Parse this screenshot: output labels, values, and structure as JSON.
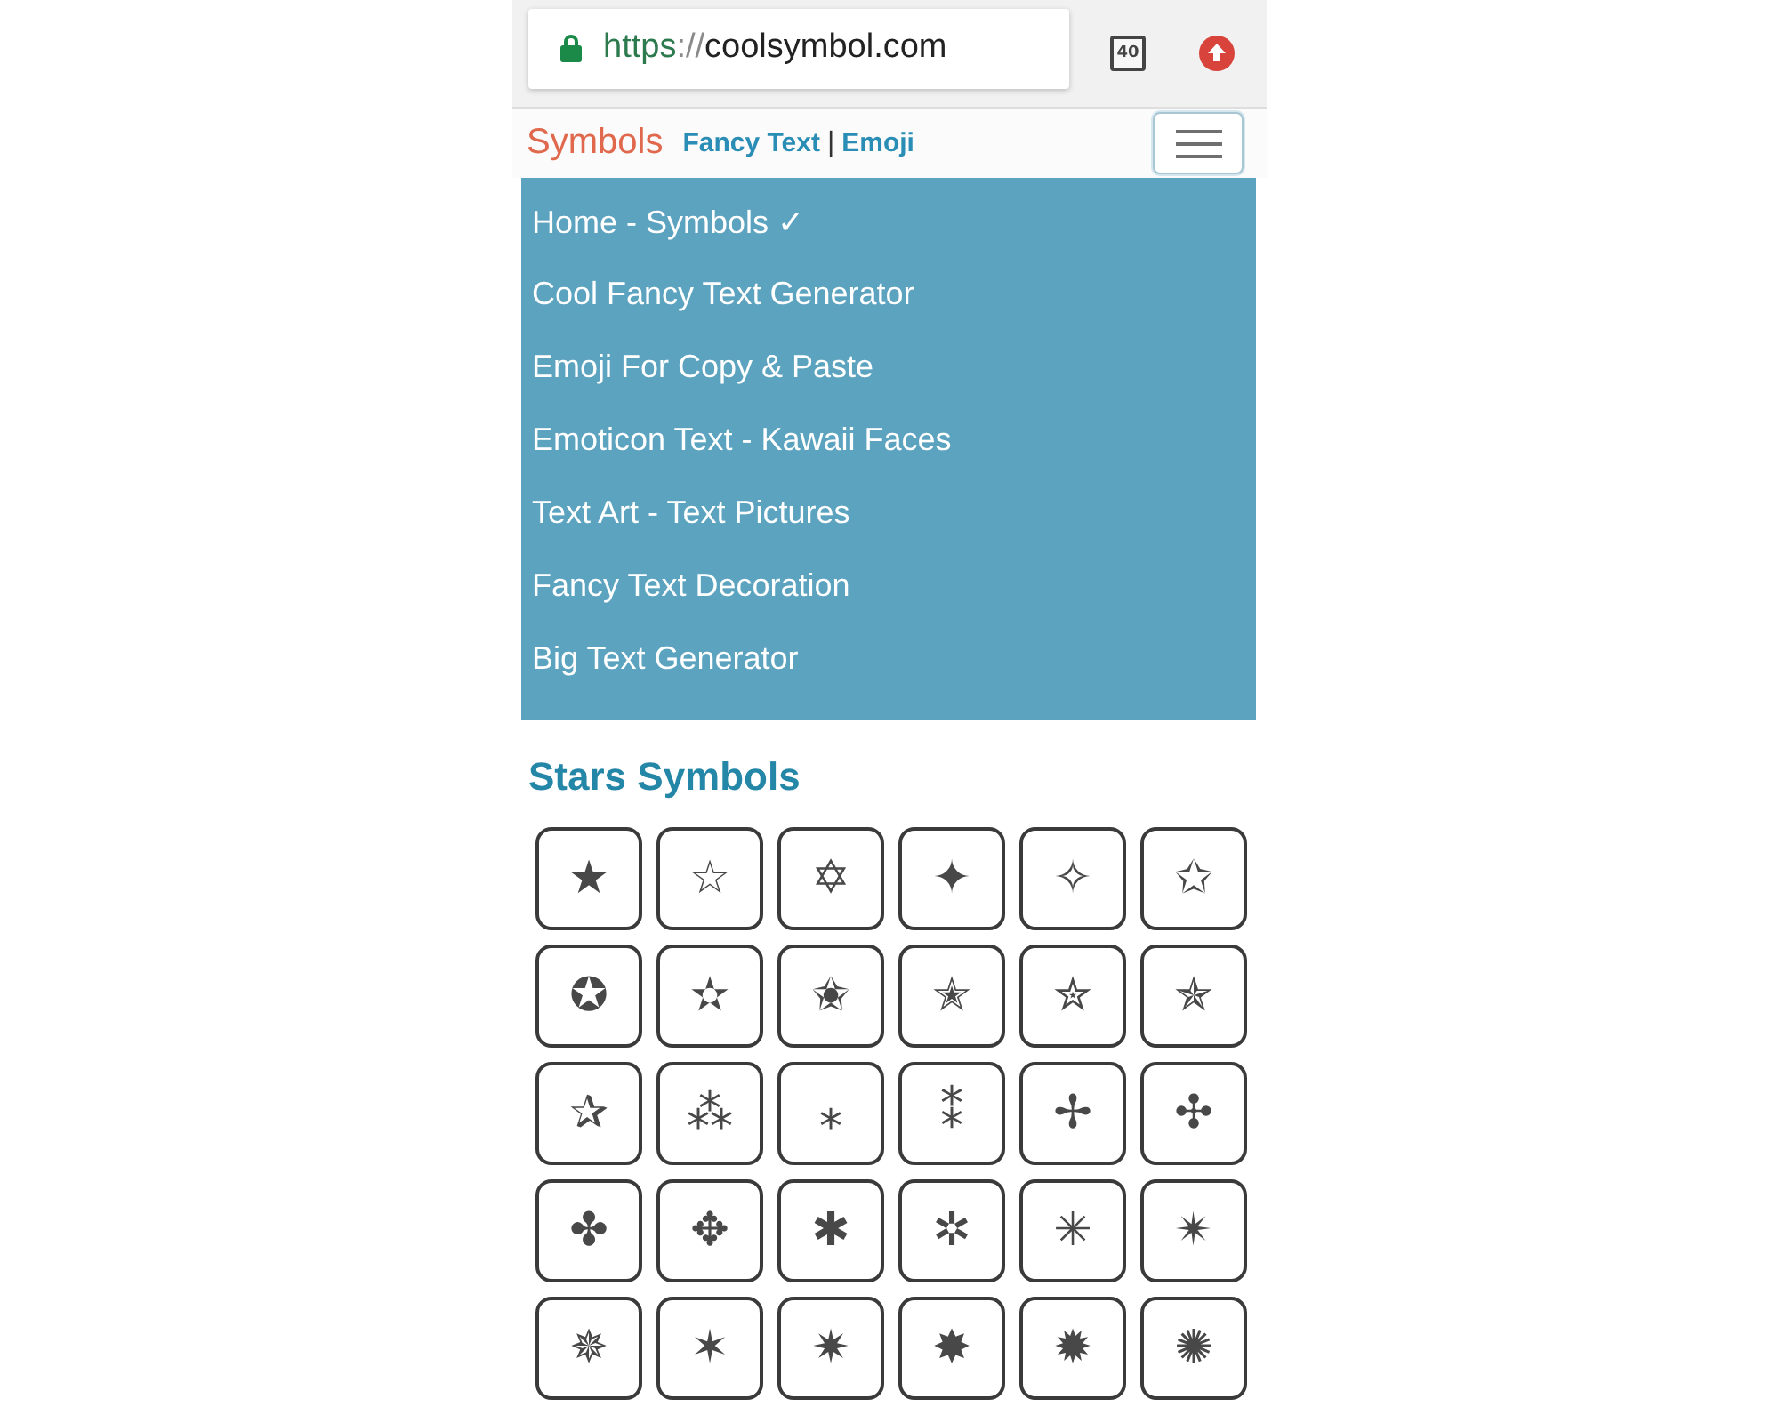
{
  "browser": {
    "url": {
      "scheme": "https",
      "separator": "://",
      "host": "coolsymbol.com"
    },
    "tab_count": "40"
  },
  "navbar": {
    "brand": "Symbols",
    "links": [
      "Fancy Text",
      "Emoji"
    ],
    "separator": "|",
    "menu_expanded": true
  },
  "menu": {
    "items": [
      "Home - Symbols ✓",
      "Cool Fancy Text Generator",
      "Emoji For Copy & Paste",
      "Emoticon Text - Kawaii Faces",
      "Text Art - Text Pictures",
      "Fancy Text Decoration",
      "Big Text Generator"
    ]
  },
  "content": {
    "heading": "Stars Symbols",
    "symbols": [
      "★",
      "☆",
      "✡",
      "✦",
      "✧",
      "✩",
      "✪",
      "✫",
      "✬",
      "✭",
      "✮",
      "✯",
      "✰",
      "⁂",
      "⁎",
      "⁑",
      "✢",
      "✣",
      "✤",
      "✥",
      "✱",
      "✲",
      "✳",
      "✴",
      "✵",
      "✶",
      "✷",
      "✸",
      "✹",
      "✺"
    ]
  }
}
